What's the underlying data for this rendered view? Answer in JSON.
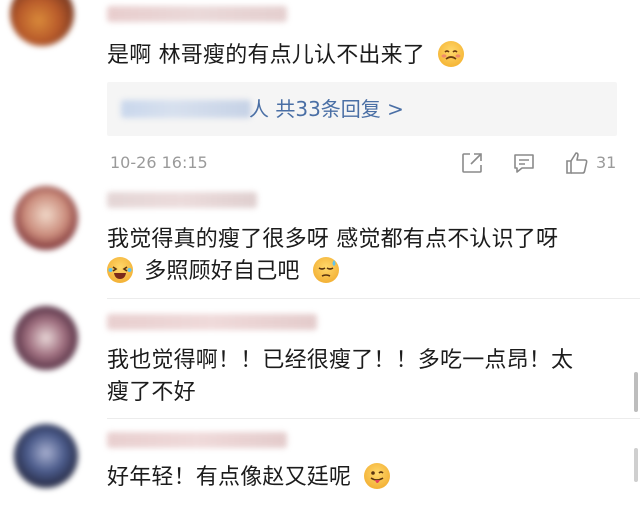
{
  "comments": [
    {
      "text": "是啊 林哥瘦的有点儿认不出来了"
    },
    {
      "line1": "我觉得真的瘦了很多呀 感觉都有点不认识了呀",
      "line2": "多照顾好自己吧"
    },
    {
      "line1": "我也觉得啊！！已经很瘦了！！多吃一点昂！太",
      "line2": "瘦了不好"
    },
    {
      "text": "好年轻！有点像赵又廷呢"
    }
  ],
  "reply_summary": {
    "suffix": "人 共33条回复 >"
  },
  "meta": {
    "timestamp": "10-26 16:15",
    "like_count": "31"
  },
  "icons": [
    "share-icon",
    "comment-icon",
    "like-icon",
    "woozy-emoji",
    "laughing-emoji",
    "sweat-emoji",
    "tongue-emoji"
  ],
  "colors": {
    "link": "#4a6fa5",
    "text": "#1c1c1c",
    "meta": "#9a9a9a",
    "reply_bg": "#f5f5f5"
  }
}
